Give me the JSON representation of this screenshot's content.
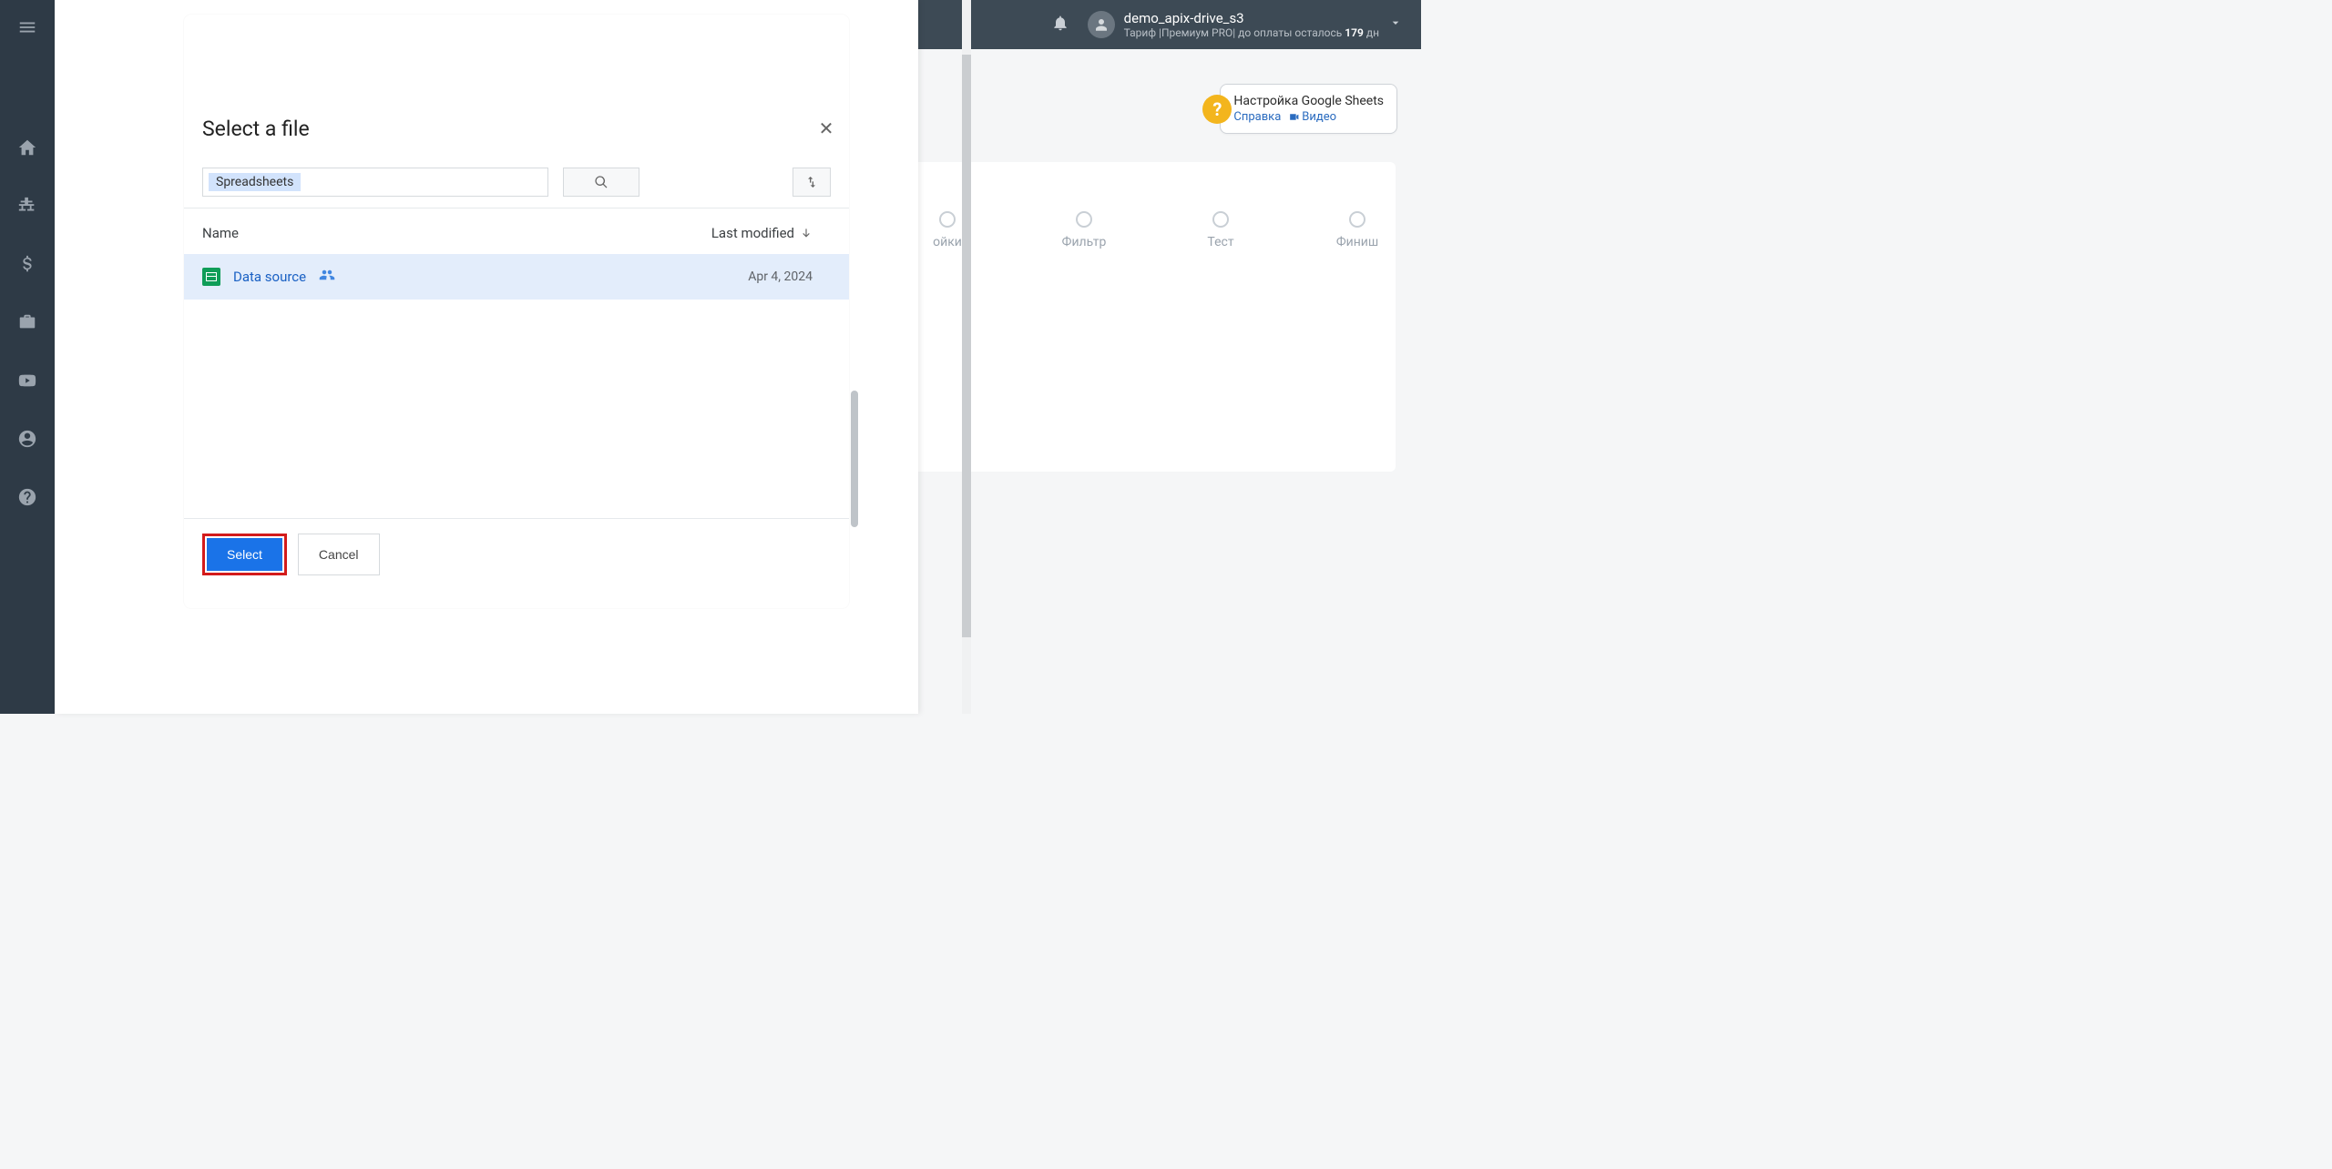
{
  "topbar": {
    "user_name": "demo_apix-drive_s3",
    "tariff_prefix": "Тариф |Премиум PRO| до оплаты осталось ",
    "tariff_days": "179",
    "tariff_suffix": " дн"
  },
  "helpbox": {
    "title": "Настройка Google Sheets",
    "link_text": "Справка",
    "video_text": "Видео"
  },
  "stepper": {
    "step1": "ойки",
    "step2": "Фильтр",
    "step3": "Тест",
    "step4": "Финиш"
  },
  "dialog": {
    "title": "Select a file",
    "search_chip": "Spreadsheets",
    "col_name": "Name",
    "col_modified": "Last modified",
    "select_btn": "Select",
    "cancel_btn": "Cancel"
  },
  "files": {
    "row0": {
      "name": "Data source",
      "date": "Apr 4, 2024"
    }
  }
}
